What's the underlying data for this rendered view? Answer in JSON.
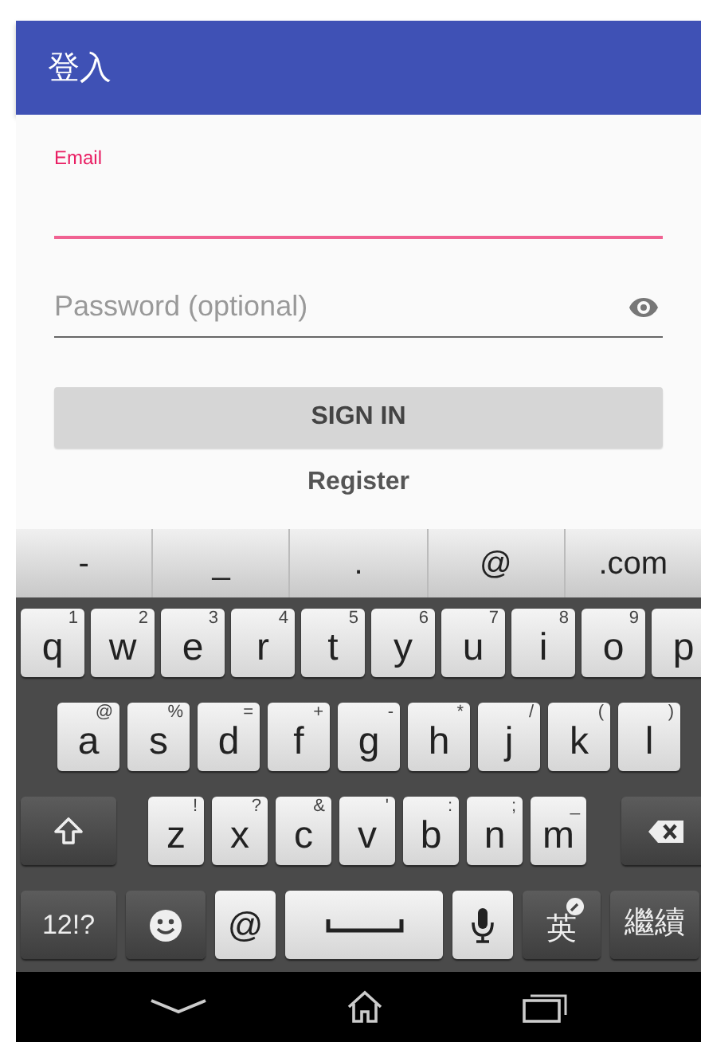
{
  "app_bar": {
    "title": "登入"
  },
  "form": {
    "email": {
      "label": "Email",
      "focused": true
    },
    "password": {
      "placeholder": "Password (optional)"
    },
    "sign_in": "SIGN IN",
    "register": "Register"
  },
  "keyboard": {
    "suggestions": [
      "-",
      "_",
      ".",
      "@",
      ".com"
    ],
    "rows": [
      {
        "keys": [
          {
            "kind": "letter",
            "label": "q",
            "hint": "1"
          },
          {
            "kind": "letter",
            "label": "w",
            "hint": "2"
          },
          {
            "kind": "letter",
            "label": "e",
            "hint": "3"
          },
          {
            "kind": "letter",
            "label": "r",
            "hint": "4"
          },
          {
            "kind": "letter",
            "label": "t",
            "hint": "5"
          },
          {
            "kind": "letter",
            "label": "y",
            "hint": "6"
          },
          {
            "kind": "letter",
            "label": "u",
            "hint": "7"
          },
          {
            "kind": "letter",
            "label": "i",
            "hint": "8"
          },
          {
            "kind": "letter",
            "label": "o",
            "hint": "9"
          },
          {
            "kind": "letter",
            "label": "p"
          }
        ]
      },
      {
        "keys": [
          {
            "kind": "letter",
            "label": "a",
            "hint": "@"
          },
          {
            "kind": "letter",
            "label": "s",
            "hint": "%"
          },
          {
            "kind": "letter",
            "label": "d",
            "hint": "="
          },
          {
            "kind": "letter",
            "label": "f",
            "hint": "+"
          },
          {
            "kind": "letter",
            "label": "g",
            "hint": "-"
          },
          {
            "kind": "letter",
            "label": "h",
            "hint": "*"
          },
          {
            "kind": "letter",
            "label": "j",
            "hint": "/"
          },
          {
            "kind": "letter",
            "label": "k",
            "hint": "("
          },
          {
            "kind": "letter",
            "label": "l",
            "hint": ")"
          }
        ]
      },
      {
        "keys": [
          {
            "kind": "shift"
          },
          {
            "kind": "letter",
            "label": "z",
            "hint": "!"
          },
          {
            "kind": "letter",
            "label": "x",
            "hint": "?"
          },
          {
            "kind": "letter",
            "label": "c",
            "hint": "&"
          },
          {
            "kind": "letter",
            "label": "v",
            "hint": "'"
          },
          {
            "kind": "letter",
            "label": "b",
            "hint": ":"
          },
          {
            "kind": "letter",
            "label": "n",
            "hint": ";"
          },
          {
            "kind": "letter",
            "label": "m",
            "hint": "_"
          },
          {
            "kind": "backspace"
          }
        ]
      },
      {
        "keys": [
          {
            "kind": "symbols",
            "label": "12!?"
          },
          {
            "kind": "emoji"
          },
          {
            "kind": "at",
            "label": "@"
          },
          {
            "kind": "space"
          },
          {
            "kind": "mic"
          },
          {
            "kind": "language",
            "label": "英"
          },
          {
            "kind": "action",
            "label": "繼續"
          }
        ]
      }
    ]
  }
}
